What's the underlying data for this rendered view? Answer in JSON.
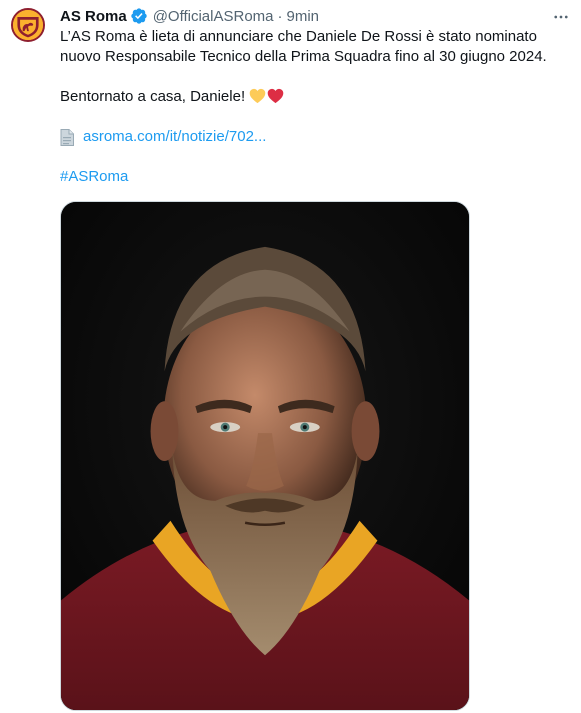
{
  "author": {
    "name": "AS Roma",
    "handle": "@OfficialASRoma",
    "separator": "·",
    "time": "9min",
    "avatar_icon": "as-roma-crest-icon",
    "verified_icon": "verified-badge-icon"
  },
  "more_icon": "more-horizontal-icon",
  "text": {
    "line1": "L’AS Roma è lieta di annunciare che Daniele De Rossi è stato nominato",
    "line2": "nuovo Responsabile Tecnico della Prima Squadra fino al 30 giugno 2024.",
    "line3": "Bentornato a casa, Daniele!",
    "hearts": [
      "yellow-heart-icon",
      "red-heart-icon"
    ]
  },
  "link": {
    "text": "asroma.com/it/notizie/702...",
    "icon": "document-icon"
  },
  "hashtag": "#ASRoma",
  "colors": {
    "link": "#1d9bf0",
    "secondary_text": "#536471",
    "primary_text": "#0f1419",
    "roma_red": "#8e1f2f",
    "roma_yellow": "#fbb12e"
  }
}
